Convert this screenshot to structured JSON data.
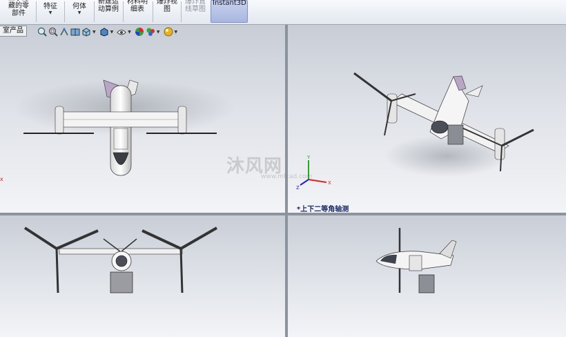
{
  "ribbon": {
    "buttons": [
      {
        "label": "显示隐\n藏的零\n部件"
      },
      {
        "label": "特征",
        "has_dropdown": true
      },
      {
        "label": "何体",
        "has_dropdown": true
      },
      {
        "label": "新建运\n动算例"
      },
      {
        "label": "材料明\n细表"
      },
      {
        "label": "爆炸视\n图"
      },
      {
        "label": "爆炸直\n线草图",
        "disabled": true
      },
      {
        "label": "Instant3D",
        "active": true
      }
    ]
  },
  "tree_tab": {
    "label": "室产品"
  },
  "view_toolbar": {
    "icons": [
      "zoom-to-fit-icon",
      "zoom-to-area-icon",
      "previous-view-icon",
      "section-view-icon",
      "view-orientation-icon",
      "display-style-icon",
      "hide-show-items-icon",
      "edit-appearance-icon",
      "apply-scene-icon",
      "view-settings-icon"
    ]
  },
  "viewports": {
    "isometric_label": "*上下二等角轴测",
    "triad_axes": {
      "x": "X",
      "y": "Y",
      "z": "Z"
    }
  },
  "watermark": {
    "main": "沐风网",
    "url": "www.mfcad.com"
  },
  "colors": {
    "accent": "#1a2a66",
    "triad_x": "#d22",
    "triad_y": "#2a2",
    "triad_z": "#22c"
  }
}
